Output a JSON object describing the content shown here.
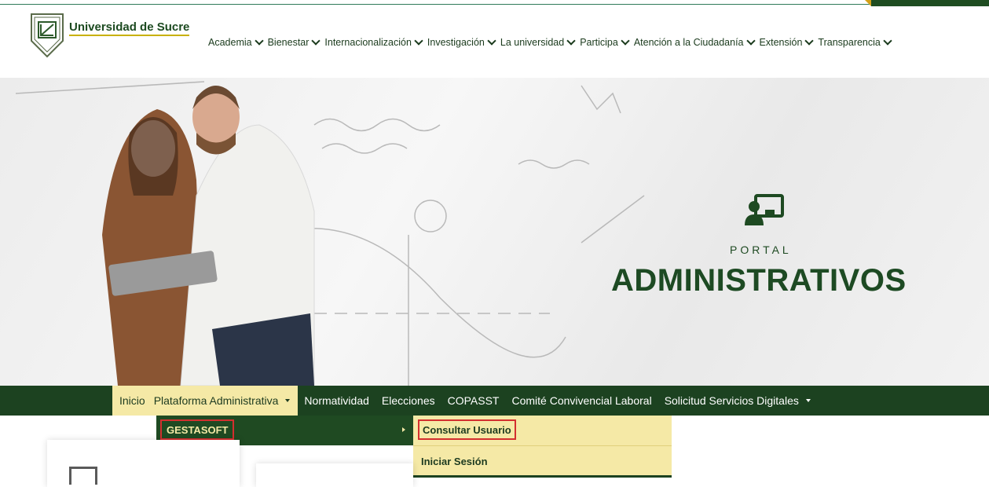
{
  "header": {
    "brand": "Universidad de Sucre",
    "nav": [
      {
        "label": "Academia"
      },
      {
        "label": "Bienestar"
      },
      {
        "label": "Internacionalización"
      },
      {
        "label": "Investigación"
      },
      {
        "label": "La universidad"
      },
      {
        "label": "Participa"
      },
      {
        "label": "Atención a la Ciudadanía"
      },
      {
        "label": "Extensión"
      },
      {
        "label": "Transparencia"
      }
    ]
  },
  "hero": {
    "kicker": "PORTAL",
    "title": "ADMINISTRATIVOS",
    "icon": "user-presentation-icon"
  },
  "menu": {
    "items": [
      {
        "label": "Inicio"
      },
      {
        "label": "Plataforma Administrativa"
      },
      {
        "label": "Normatividad"
      },
      {
        "label": "Elecciones"
      },
      {
        "label": "COPASST"
      },
      {
        "label": "Comité Convivencial Laboral"
      },
      {
        "label": "Solicitud Servicios Digitales"
      }
    ]
  },
  "dropdown": {
    "level1": "GESTASOFT",
    "level2": [
      "Consultar Usuario",
      "Iniciar Sesión"
    ]
  },
  "colors": {
    "brand_green": "#1c4220",
    "highlight_yellow": "#f5e9a6",
    "annotation_red": "#d32f2f"
  }
}
